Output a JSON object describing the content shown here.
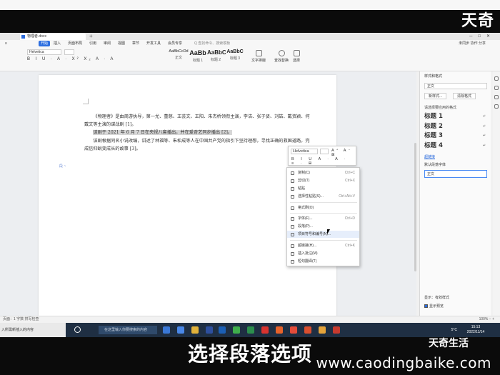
{
  "video": {
    "brand_top": "天奇",
    "caption": "选择段落选项",
    "brand_bottom": "天奇生活",
    "watermark": "www.caodingbaike.com"
  },
  "app": {
    "tab_title": "物理者.docx",
    "menu": [
      "开始",
      "插入",
      "页面布局",
      "引用",
      "审阅",
      "视图",
      "章节",
      "开发工具",
      "会员专享"
    ],
    "active_menu": "开始",
    "search_hint": "Q 查找命令、搜索模板",
    "menu_right": "未同步  协作  分享"
  },
  "ribbon": {
    "font": "Helvetica",
    "formatting": "B I U ∙ A ∙ X² X₂ A ∙ A",
    "styles": [
      {
        "sample": "AaBbCcDd",
        "name": "正文"
      },
      {
        "sample": "AaBb",
        "name": "标题 1"
      },
      {
        "sample": "AaBbC",
        "name": "标题 2"
      },
      {
        "sample": "AaBbC",
        "name": "标题 3"
      }
    ],
    "buttons": [
      "文字排版",
      "查找替换",
      "选择"
    ]
  },
  "document": {
    "para1": "《物理者》是由周游执导，第一尤、董慈、王芸文、王阳、朱杰桥领衔主演，李洁、张子贤、刘喆、戴资颖、何戴文等主演的谍战剧 [1]。",
    "para2": "该剧于 2021 年 6 月 7 日在央视八套播出，并在爱奇艺同步播出 [2]。",
    "para3": "该剧根据同名小说改编，讲述了林福等、朱松成等人在中国共产党的指引下坚持理想，寻找正确的救国道路，完成信仰蜕变成长的故事 [3]。",
    "para_marker": "段 ~"
  },
  "mini_toolbar": {
    "font": "Helvetica",
    "row1": "A⁺ A⁻ ⊠",
    "row2": "B I U A ∙ A ∙ ≡ ∙ ⊞"
  },
  "context_menu": [
    {
      "label": "复制(C)",
      "shortcut": "Ctrl+C"
    },
    {
      "label": "剪切(T)",
      "shortcut": "Ctrl+X"
    },
    {
      "label": "粘贴",
      "shortcut": ""
    },
    {
      "label": "选择性粘贴(S)...",
      "shortcut": "Ctrl+Alt+V"
    },
    {
      "label": "格式刷(O)",
      "shortcut": ""
    },
    {
      "label": "字体(F)...",
      "shortcut": "Ctrl+D"
    },
    {
      "label": "段落(P)...",
      "shortcut": ""
    },
    {
      "label": "项目符号和编号(N)...",
      "shortcut": ""
    },
    {
      "label": "超链接(H)...",
      "shortcut": "Ctrl+K"
    },
    {
      "label": "插入批注(M)",
      "shortcut": ""
    },
    {
      "label": "短句翻译(T)",
      "shortcut": ""
    }
  ],
  "style_pane": {
    "title": "样式和格式",
    "current": "正文",
    "new_button": "新样式...",
    "clear_button": "清除格式",
    "label": "请选择要应用的格式",
    "headings": [
      "标题 1",
      "标题 2",
      "标题 3",
      "标题 4"
    ],
    "link": "超链接",
    "set_default": "默认段落字体",
    "normal": "正文",
    "show": "显示：有效样式",
    "preview": "显示预览"
  },
  "status": {
    "left": "页面：1  字数  拼写检查",
    "right": "100%  −  +"
  },
  "taskbar": {
    "tip": "入所需新插入的内容",
    "search": "在这里输入你要搜索的内容",
    "weather": "5°C",
    "time": "15:13",
    "date": "2022/11/14"
  }
}
